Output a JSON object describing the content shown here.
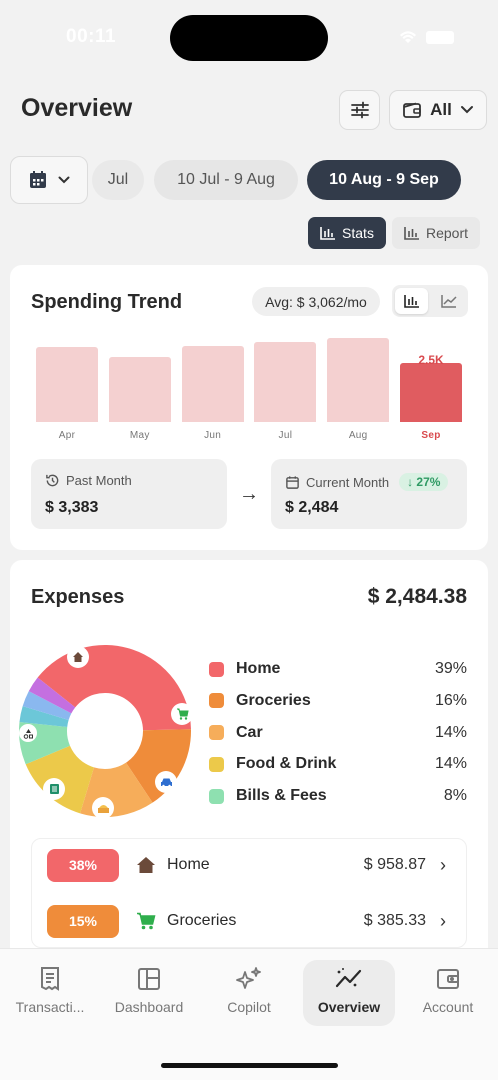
{
  "status": {
    "time": "00:11"
  },
  "header": {
    "title": "Overview",
    "account_filter": "All"
  },
  "periods": [
    "Jul",
    "10 Jul - 9 Aug",
    "10 Aug - 9 Sep"
  ],
  "view_toggle": {
    "stats": "Stats",
    "report": "Report"
  },
  "trend": {
    "title": "Spending Trend",
    "avg": "Avg: $ 3,062/mo",
    "current_value_label": "2.5K",
    "past_month_label": "Past Month",
    "past_month_value": "$ 3,383",
    "current_month_label": "Current Month",
    "current_month_value": "$ 2,484",
    "change": "↓ 27%"
  },
  "chart_data": {
    "type": "bar",
    "categories": [
      "Apr",
      "May",
      "Jun",
      "Jul",
      "Aug",
      "Sep"
    ],
    "values": [
      3150,
      2750,
      3200,
      3350,
      3550,
      2484
    ],
    "highlight": "Sep",
    "ylim": [
      0,
      4000
    ],
    "grid": false
  },
  "expenses": {
    "title": "Expenses",
    "total": "$ 2,484.38",
    "legend": [
      {
        "name": "Home",
        "pct": "39%",
        "color": "#f2676a"
      },
      {
        "name": "Groceries",
        "pct": "16%",
        "color": "#ef8c3a"
      },
      {
        "name": "Car",
        "pct": "14%",
        "color": "#f6ad5a"
      },
      {
        "name": "Food & Drink",
        "pct": "14%",
        "color": "#ecc94a"
      },
      {
        "name": "Bills & Fees",
        "pct": "8%",
        "color": "#8ee0b0"
      }
    ],
    "donut_extra": [
      {
        "color": "#6cc7d8",
        "value": 3
      },
      {
        "color": "#8ab8ef",
        "value": 3
      },
      {
        "color": "#c46fe0",
        "value": 3
      }
    ],
    "list": [
      {
        "badge": "38%",
        "name": "Home",
        "amount": "$ 958.87",
        "color": "#f2676a",
        "icon": "house-icon"
      },
      {
        "badge": "15%",
        "name": "Groceries",
        "amount": "$ 385.33",
        "color": "#ef8c3a",
        "icon": "cart-icon"
      }
    ]
  },
  "tabs": [
    {
      "label": "Transacti...",
      "icon": "receipt-icon"
    },
    {
      "label": "Dashboard",
      "icon": "dashboard-icon"
    },
    {
      "label": "Copilot",
      "icon": "sparkle-icon"
    },
    {
      "label": "Overview",
      "icon": "trend-icon",
      "active": true
    },
    {
      "label": "Account",
      "icon": "wallet-icon"
    }
  ]
}
